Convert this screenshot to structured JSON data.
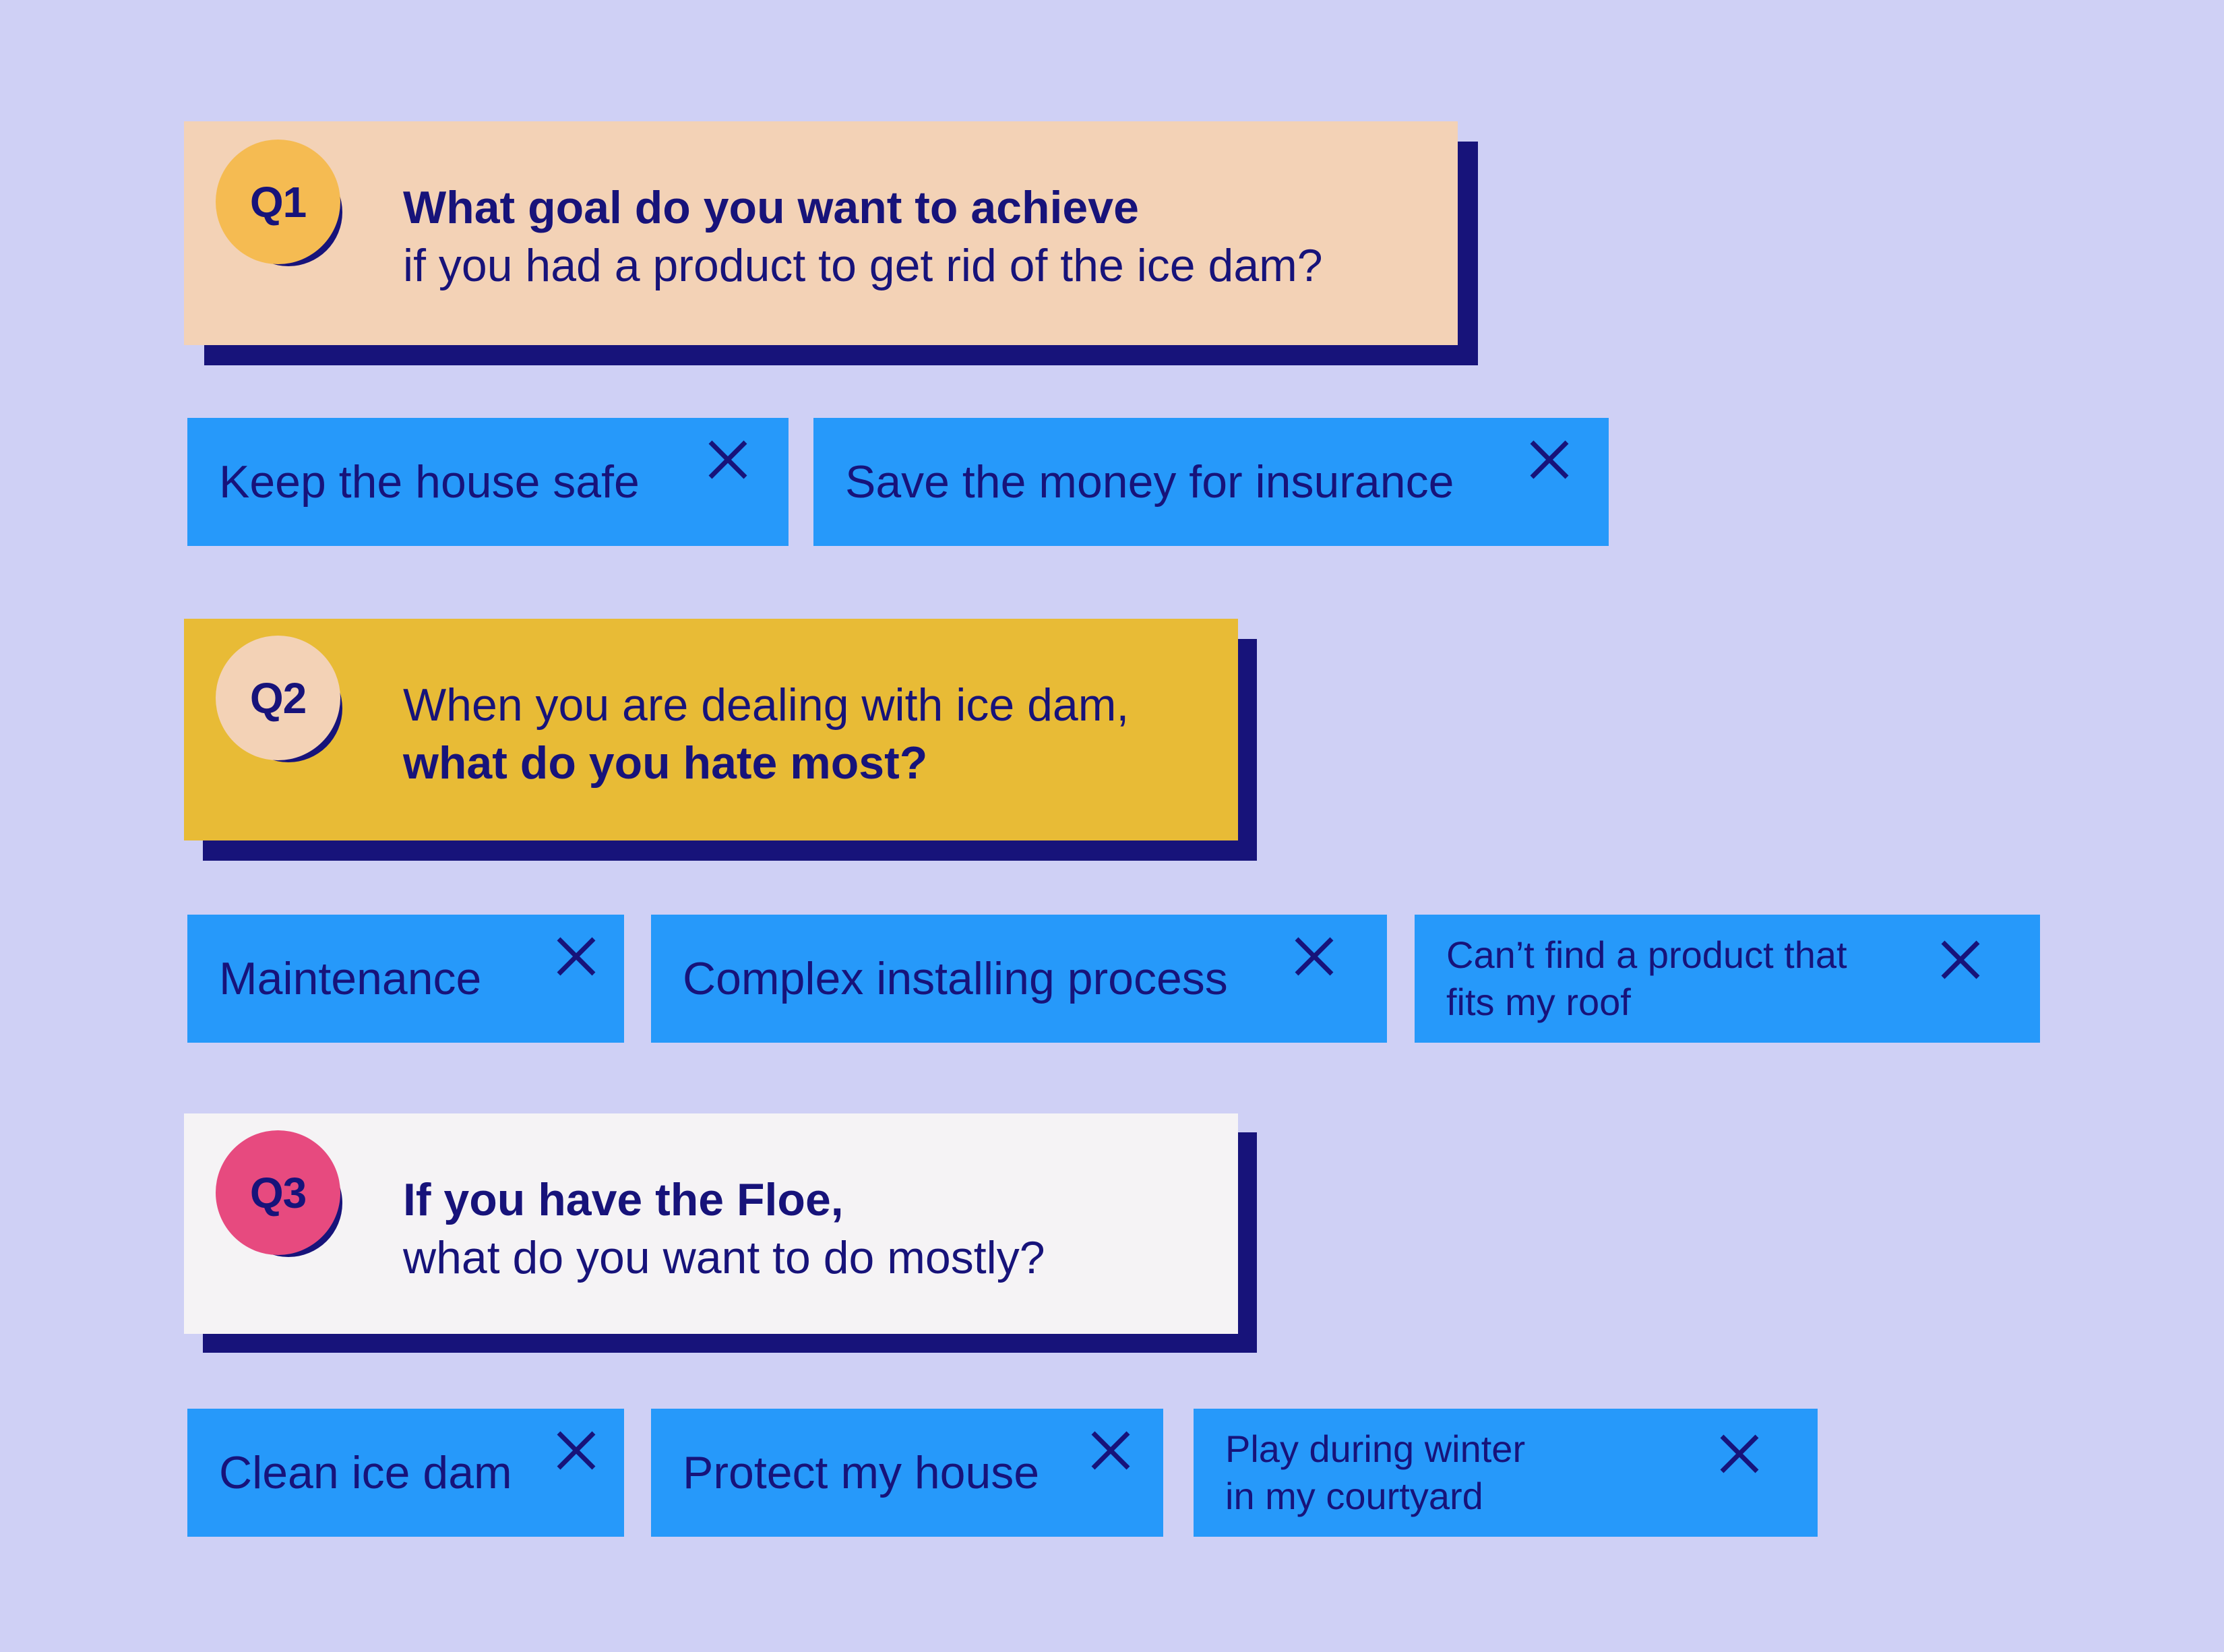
{
  "colors": {
    "background": "#cfd0f5",
    "ink": "#17137a",
    "chip": "#2699fa",
    "q1_card": "#f3d2b6",
    "q1_badge": "#f5bb52",
    "q2_card": "#e8bb36",
    "q2_badge": "#f3d2b6",
    "q3_card": "#f5f3f5",
    "q3_badge": "#e74a7f"
  },
  "questions": [
    {
      "badge": "Q1",
      "line1": "What goal do you want to achieve",
      "line2": "if you had a product to get rid of the ice dam?",
      "emphasis": "line1",
      "answers": [
        "Keep the house safe",
        "Save the money for insurance"
      ]
    },
    {
      "badge": "Q2",
      "line1": "When you are dealing with ice dam,",
      "line2": "what do you hate most?",
      "emphasis": "line2",
      "answers": [
        "Maintenance",
        "Complex installing process",
        "Can’t find a product that fits my roof"
      ]
    },
    {
      "badge": "Q3",
      "line1": "If you have the Floe,",
      "line2": "what do you want to do mostly?",
      "emphasis": "line1",
      "answers": [
        "Clean ice dam",
        "Protect my house",
        "Play during winter in my courtyard"
      ]
    }
  ],
  "answer_lines": {
    "q2_a3_line1": "Can’t find a product that",
    "q2_a3_line2": "fits my roof",
    "q3_a3_line1": "Play during winter",
    "q3_a3_line2": "in my courtyard"
  },
  "icons": {
    "remove": "close-x-icon"
  }
}
